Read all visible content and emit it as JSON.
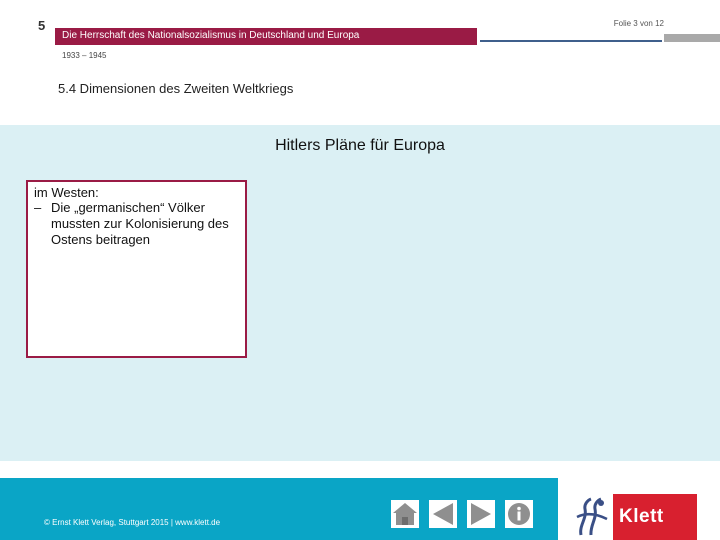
{
  "header": {
    "chapter_number": "5",
    "slide_counter": "Folie 3 von 12",
    "chapter_title": "Die Herrschaft des Nationalsozialismus in Deutschland und Europa",
    "years": "1933 – 1945",
    "section_title": "5.4 Dimensionen des Zweiten Weltkriegs"
  },
  "main": {
    "heading": "Hitlers Pläne für Europa",
    "box": {
      "heading": "im Westen:",
      "items": [
        {
          "bullet": "–",
          "text": "Die „germanischen“ Völker mussten zur Kolonisierung des Ostens beitragen"
        }
      ]
    }
  },
  "footer": {
    "copyright": "© Ernst Klett Verlag, Stuttgart 2015 | www.klett.de",
    "nav": [
      "home-icon",
      "previous-icon",
      "next-icon",
      "info-icon"
    ]
  },
  "logo": {
    "text": "Klett"
  },
  "colors": {
    "accent": "#9a1b45",
    "content_background": "#dbf0f4",
    "footer_band": "#0aa5c6",
    "logo_red": "#d8202f",
    "header_line_blue": "#3f5f8c"
  }
}
